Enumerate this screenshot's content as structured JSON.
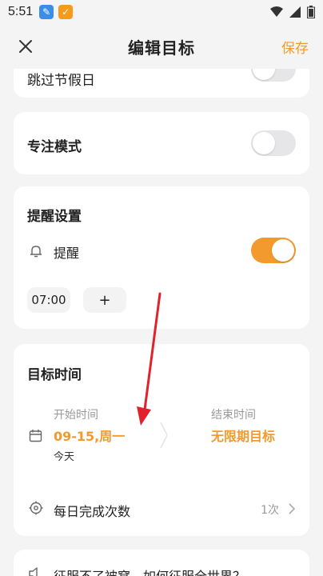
{
  "status_bar": {
    "time": "5:51"
  },
  "header": {
    "title": "编辑目标",
    "save_label": "保存"
  },
  "skip_holidays": {
    "label": "跳过节假日",
    "enabled": false
  },
  "focus_mode": {
    "label": "专注模式",
    "enabled": false
  },
  "reminder": {
    "title": "提醒设置",
    "item_label": "提醒",
    "enabled": true,
    "time": "07:00",
    "add_label": "+"
  },
  "goal_time": {
    "title": "目标时间",
    "start_label": "开始时间",
    "start_value": "09-15,周一",
    "start_sub": "今天",
    "end_label": "结束时间",
    "end_value": "无限期目标",
    "daily_label": "每日完成次数",
    "daily_value": "1次"
  },
  "quote": {
    "text": "征服不了被窝，如何征服全世界？"
  },
  "colors": {
    "accent": "#f39a2e",
    "arrow": "#e0222e"
  }
}
